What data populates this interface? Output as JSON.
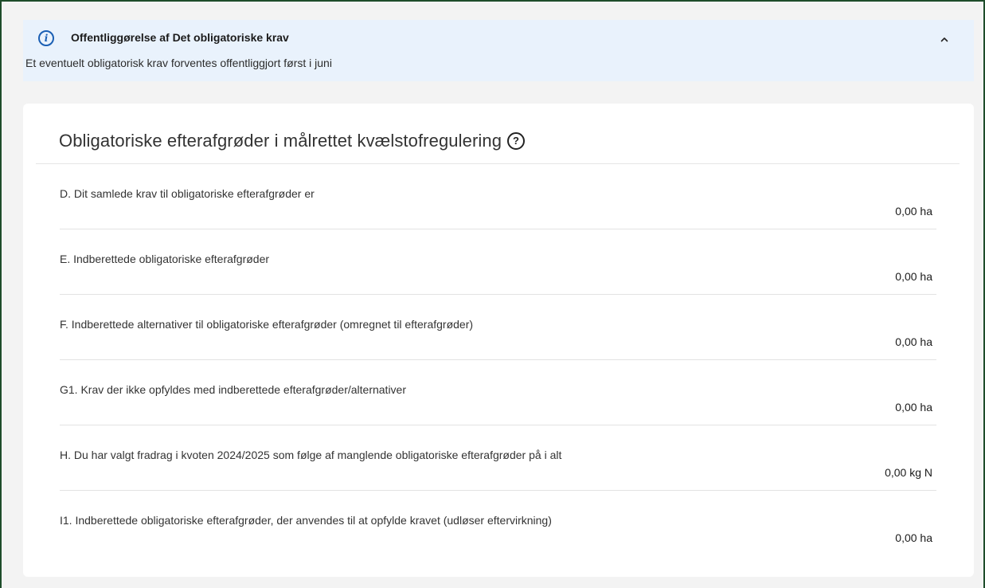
{
  "banner": {
    "icon": "info-icon",
    "icon_glyph": "i",
    "title": "Offentliggørelse af Det obligatoriske krav",
    "text": "Et eventuelt obligatorisk krav forventes offentliggjort først i juni",
    "toggle_icon": "chevron-up-icon"
  },
  "card": {
    "title": "Obligatoriske efterafgrøder i målrettet kvælstofregulering",
    "help_icon_glyph": "?",
    "rows": [
      {
        "label": "D. Dit samlede krav til obligatoriske efterafgrøder er",
        "value": "0,00 ha"
      },
      {
        "label": "E. Indberettede obligatoriske efterafgrøder",
        "value": "0,00 ha"
      },
      {
        "label": "F. Indberettede alternativer til obligatoriske efterafgrøder (omregnet til efterafgrøder)",
        "value": "0,00 ha"
      },
      {
        "label": "G1. Krav der ikke opfyldes med indberettede efterafgrøder/alternativer",
        "value": "0,00 ha"
      },
      {
        "label": "H. Du har valgt fradrag i kvoten 2024/2025 som følge af manglende obligatoriske efterafgrøder på i alt",
        "value": "0,00 kg N"
      },
      {
        "label": "I1. Indberettede obligatoriske efterafgrøder, der anvendes til at opfylde kravet (udløser eftervirkning)",
        "value": "0,00 ha"
      }
    ]
  },
  "colors": {
    "frame_border": "#1e4d2b",
    "banner_bg": "#e9f2fc",
    "info_accent": "#1a5fb4",
    "card_bg": "#ffffff",
    "page_bg": "#f3f3f3"
  }
}
